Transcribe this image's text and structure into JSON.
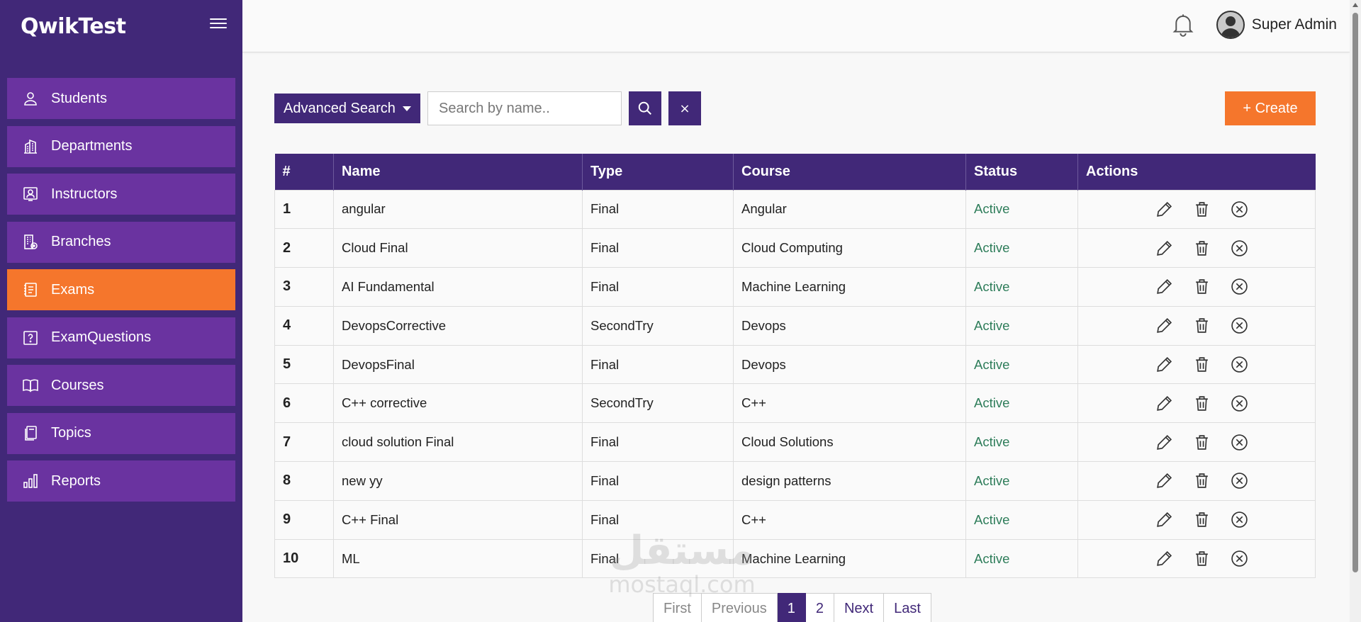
{
  "app": {
    "brand": "QwikTest"
  },
  "sidebar": {
    "items": [
      {
        "label": "Students",
        "icon": "user-icon",
        "active": false
      },
      {
        "label": "Departments",
        "icon": "building-icon",
        "active": false
      },
      {
        "label": "Instructors",
        "icon": "instructor-icon",
        "active": false
      },
      {
        "label": "Branches",
        "icon": "branch-icon",
        "active": false
      },
      {
        "label": "Exams",
        "icon": "exam-icon",
        "active": true
      },
      {
        "label": "ExamQuestions",
        "icon": "question-icon",
        "active": false
      },
      {
        "label": "Courses",
        "icon": "book-icon",
        "active": false
      },
      {
        "label": "Topics",
        "icon": "topics-icon",
        "active": false
      },
      {
        "label": "Reports",
        "icon": "chart-icon",
        "active": false
      }
    ]
  },
  "header": {
    "user_name": "Super Admin"
  },
  "toolbar": {
    "advanced_search_label": "Advanced Search",
    "search_placeholder": "Search by name..",
    "clear_label": "×",
    "create_label": "+ Create"
  },
  "table": {
    "headers": [
      "#",
      "Name",
      "Type",
      "Course",
      "Status",
      "Actions"
    ],
    "rows": [
      {
        "num": "1",
        "name": "angular",
        "type": "Final",
        "course": "Angular",
        "status": "Active"
      },
      {
        "num": "2",
        "name": "Cloud Final",
        "type": "Final",
        "course": "Cloud Computing",
        "status": "Active"
      },
      {
        "num": "3",
        "name": "AI Fundamental",
        "type": "Final",
        "course": "Machine Learning",
        "status": "Active"
      },
      {
        "num": "4",
        "name": "DevopsCorrective",
        "type": "SecondTry",
        "course": "Devops",
        "status": "Active"
      },
      {
        "num": "5",
        "name": "DevopsFinal",
        "type": "Final",
        "course": "Devops",
        "status": "Active"
      },
      {
        "num": "6",
        "name": "C++ corrective",
        "type": "SecondTry",
        "course": "C++",
        "status": "Active"
      },
      {
        "num": "7",
        "name": "cloud solution Final",
        "type": "Final",
        "course": "Cloud Solutions",
        "status": "Active"
      },
      {
        "num": "8",
        "name": "new yy",
        "type": "Final",
        "course": "design patterns",
        "status": "Active"
      },
      {
        "num": "9",
        "name": "C++ Final",
        "type": "Final",
        "course": "C++",
        "status": "Active"
      },
      {
        "num": "10",
        "name": "ML",
        "type": "Final",
        "course": "Machine Learning",
        "status": "Active"
      }
    ]
  },
  "pagination": {
    "first": "First",
    "previous": "Previous",
    "pages": [
      "1",
      "2"
    ],
    "current": "1",
    "next": "Next",
    "last": "Last"
  },
  "watermark": {
    "arabic": "مستقل",
    "latin": "mostaql.com"
  },
  "colors": {
    "primary": "#412878",
    "sidebar_item": "#6a33a0",
    "accent": "#f5762c",
    "status_active": "#2e7d5a"
  }
}
